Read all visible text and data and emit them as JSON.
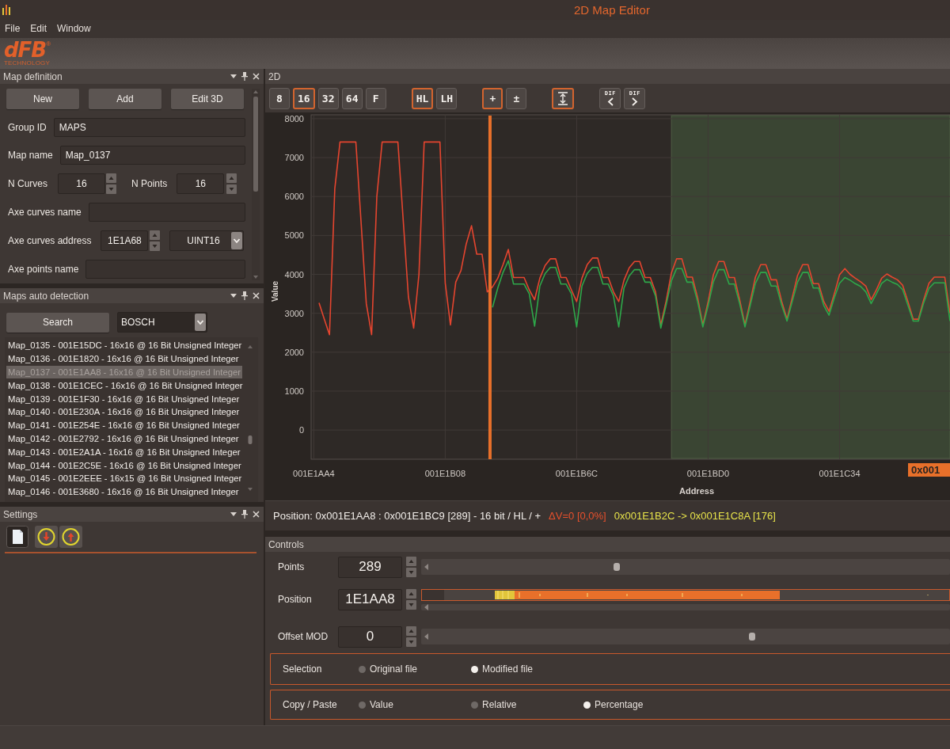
{
  "window": {
    "title": "2D Map Editor"
  },
  "menu": [
    "File",
    "Edit",
    "Window"
  ],
  "logo": {
    "wordmark": "dFB",
    "registered": "®",
    "tagline": "TECHNOLOGY"
  },
  "map_definition": {
    "title": "Map definition",
    "buttons": [
      "New",
      "Add",
      "Edit 3D"
    ],
    "fields": [
      {
        "kind": "text",
        "label": "Group ID",
        "value": "MAPS"
      },
      {
        "kind": "text",
        "label": "Map name",
        "value": "Map_0137"
      },
      {
        "kind": "spin_pair",
        "items": [
          {
            "label": "N Curves",
            "value": "16"
          },
          {
            "label": "N Points",
            "value": "16"
          }
        ]
      },
      {
        "kind": "text",
        "label": "Axe curves name"
      },
      {
        "kind": "address",
        "label": "Axe curves address",
        "value": "1E1A68",
        "type": "UINT16"
      },
      {
        "kind": "text",
        "label": "Axe points name"
      }
    ]
  },
  "maps_auto_detection": {
    "title": "Maps auto detection",
    "search_button": "Search",
    "manufacturer": "BOSCH",
    "results": [
      {
        "label": "Map_0135 - 001E15DC - 16x16 @ 16 Bit Unsigned Integer",
        "selected": false
      },
      {
        "label": "Map_0136 - 001E1820 - 16x16 @ 16 Bit Unsigned Integer",
        "selected": false
      },
      {
        "label": "Map_0137 - 001E1AA8 - 16x16 @ 16 Bit Unsigned Integer",
        "selected": true
      },
      {
        "label": "Map_0138 - 001E1CEC - 16x16 @ 16 Bit Unsigned Integer",
        "selected": false
      },
      {
        "label": "Map_0139 - 001E1F30 - 16x16 @ 16 Bit Unsigned Integer",
        "selected": false
      },
      {
        "label": "Map_0140 - 001E230A - 16x16 @ 16 Bit Unsigned Integer",
        "selected": false
      },
      {
        "label": "Map_0141 - 001E254E - 16x16 @ 16 Bit Unsigned Integer",
        "selected": false
      },
      {
        "label": "Map_0142 - 001E2792 - 16x16 @ 16 Bit Unsigned Integer",
        "selected": false
      },
      {
        "label": "Map_0143 - 001E2A1A - 16x16 @ 16 Bit Unsigned Integer",
        "selected": false
      },
      {
        "label": "Map_0144 - 001E2C5E - 16x16 @ 16 Bit Unsigned Integer",
        "selected": false
      },
      {
        "label": "Map_0145 - 001E2EEE - 16x15 @ 16 Bit Unsigned Integer",
        "selected": false
      },
      {
        "label": "Map_0146 - 001E3680 - 16x16 @ 16 Bit Unsigned Integer",
        "selected": false
      }
    ]
  },
  "settings": {
    "title": "Settings"
  },
  "editor": {
    "title": "2D",
    "toolbar": [
      {
        "buttons": [
          {
            "kind": "text",
            "label": "8",
            "selected": false
          },
          {
            "kind": "text",
            "label": "16",
            "selected": true
          },
          {
            "kind": "text",
            "label": "32",
            "selected": false
          },
          {
            "kind": "text",
            "label": "64",
            "selected": false
          },
          {
            "kind": "text",
            "label": "F",
            "selected": false
          }
        ]
      },
      {
        "buttons": [
          {
            "kind": "text",
            "label": "HL",
            "selected": true
          },
          {
            "kind": "text",
            "label": "LH",
            "selected": false
          }
        ]
      },
      {
        "buttons": [
          {
            "kind": "text",
            "label": "+",
            "selected": true
          },
          {
            "kind": "text",
            "label": "±",
            "selected": false
          }
        ]
      },
      {
        "buttons": [
          {
            "kind": "fit",
            "selected": true
          }
        ]
      },
      {
        "buttons": [
          {
            "kind": "dif_left",
            "label": "DIF",
            "selected": false
          },
          {
            "kind": "dif_right",
            "label": "DIF",
            "selected": false
          }
        ]
      }
    ],
    "chart": {
      "cursor_label": "0x001",
      "chart_data": {
        "type": "line",
        "xlabel": "Address",
        "ylabel": "Value",
        "grid": true,
        "categories": [
          "001E1AA4",
          null,
          null,
          null,
          null,
          null,
          null,
          null,
          null,
          null,
          null,
          null,
          null,
          null,
          null,
          null,
          null,
          null,
          null,
          null,
          null,
          null,
          null,
          null,
          null,
          "001E1B08",
          null,
          null,
          null,
          null,
          null,
          null,
          null,
          null,
          null,
          null,
          null,
          null,
          null,
          null,
          null,
          null,
          null,
          null,
          null,
          null,
          null,
          null,
          null,
          null,
          "001E1B6C",
          null,
          null,
          null,
          null,
          null,
          null,
          null,
          null,
          null,
          null,
          null,
          null,
          null,
          null,
          null,
          null,
          null,
          null,
          null,
          null,
          null,
          null,
          null,
          null,
          "001E1BD0",
          null,
          null,
          null,
          null,
          null,
          null,
          null,
          null,
          null,
          null,
          null,
          null,
          null,
          null,
          null,
          null,
          null,
          null,
          null,
          null,
          null,
          null,
          null,
          null,
          "001E1C34",
          null,
          null,
          null,
          null,
          null,
          null,
          null,
          null,
          null,
          null,
          null,
          null,
          null,
          null,
          null,
          null,
          null,
          null,
          null,
          null,
          null
        ],
        "series": [
          {
            "color": "#e5452f",
            "values": [
              null,
              3270,
              2850,
              2450,
              6200,
              7400,
              7400,
              7400,
              7400,
              5340,
              3250,
              2450,
              6000,
              7400,
              7400,
              7400,
              7400,
              5430,
              3420,
              2620,
              4000,
              7400,
              7400,
              7400,
              7400,
              3780,
              2700,
              3800,
              4100,
              4780,
              5250,
              4520,
              4520,
              3550,
              3680,
              3900,
              4250,
              4640,
              3920,
              3920,
              3920,
              3600,
              3350,
              3900,
              4230,
              4400,
              4400,
              3920,
              3920,
              3600,
              3300,
              3900,
              4250,
              4420,
              4420,
              3920,
              3920,
              3550,
              3300,
              3850,
              4170,
              4330,
              4330,
              3920,
              3920,
              3550,
              2700,
              3300,
              4030,
              4400,
              4400,
              3930,
              3930,
              3400,
              2700,
              3300,
              3990,
              4330,
              4330,
              3920,
              3920,
              3350,
              2700,
              3300,
              3930,
              4250,
              4250,
              3860,
              3860,
              3300,
              2850,
              3400,
              3970,
              4250,
              4250,
              3760,
              3760,
              3300,
              3050,
              3500,
              3990,
              4150,
              4000,
              3900,
              3810,
              3700,
              3350,
              3600,
              3900,
              4010,
              3930,
              3860,
              3720,
              3300,
              2850,
              2850,
              3350,
              3770,
              3930,
              3930,
              3930,
              3000
            ]
          },
          {
            "color": "#2ea84a",
            "values": [
              null,
              null,
              null,
              null,
              null,
              null,
              null,
              null,
              null,
              null,
              null,
              null,
              null,
              null,
              null,
              null,
              null,
              null,
              null,
              null,
              null,
              null,
              null,
              null,
              null,
              null,
              null,
              null,
              null,
              null,
              null,
              null,
              null,
              null,
              3150,
              3650,
              4050,
              4350,
              3750,
              3750,
              3750,
              3500,
              2670,
              3700,
              4020,
              4180,
              4180,
              3750,
              3750,
              3500,
              2650,
              3700,
              4020,
              4180,
              4180,
              3750,
              3750,
              3450,
              2650,
              3650,
              3960,
              4120,
              4120,
              3800,
              3800,
              3450,
              2620,
              3200,
              3830,
              4150,
              4150,
              3800,
              3800,
              3300,
              2650,
              3200,
              3810,
              4120,
              4120,
              3750,
              3750,
              3250,
              2650,
              3200,
              3770,
              4050,
              4050,
              3700,
              3700,
              3200,
              2800,
              3300,
              3800,
              4050,
              4050,
              3650,
              3650,
              3200,
              2950,
              3400,
              3770,
              3920,
              3850,
              3760,
              3690,
              3550,
              3250,
              3500,
              3770,
              3870,
              3800,
              3740,
              3610,
              3200,
              2800,
              2800,
              3270,
              3640,
              3780,
              3780,
              3780,
              2800
            ]
          }
        ],
        "ylim": [
          -750,
          8100
        ],
        "yticks": [
          0,
          1000,
          2000,
          3000,
          4000,
          5000,
          6000,
          7000,
          8000
        ]
      }
    },
    "readout": [
      {
        "kind": "position",
        "text": "Position: 0x001E1AA8 : 0x001E1BC9 [289] - 16 bit / HL / +"
      },
      {
        "kind": "delta",
        "text": "ΔV=0 [0,0%]"
      },
      {
        "kind": "range",
        "text": "0x001E1B2C -> 0x001E1C8A [176]"
      }
    ]
  },
  "controls": {
    "title": "Controls",
    "rows": [
      {
        "kind": "slider",
        "label": "Points",
        "value": "289",
        "level": 0.37
      },
      {
        "kind": "position",
        "label": "Position",
        "value": "1E1AA8"
      },
      {
        "kind": "slider",
        "label": "Offset MOD",
        "value": "0",
        "level": 0.625
      }
    ],
    "groups": [
      {
        "label": "Selection",
        "options": [
          {
            "label": "Original file",
            "selected": false
          },
          {
            "label": "Modified file",
            "selected": true
          }
        ]
      },
      {
        "label": "Copy / Paste",
        "options": [
          {
            "label": "Value",
            "selected": false
          },
          {
            "label": "Relative",
            "selected": false
          },
          {
            "label": "Percentage",
            "selected": true
          }
        ]
      }
    ]
  }
}
